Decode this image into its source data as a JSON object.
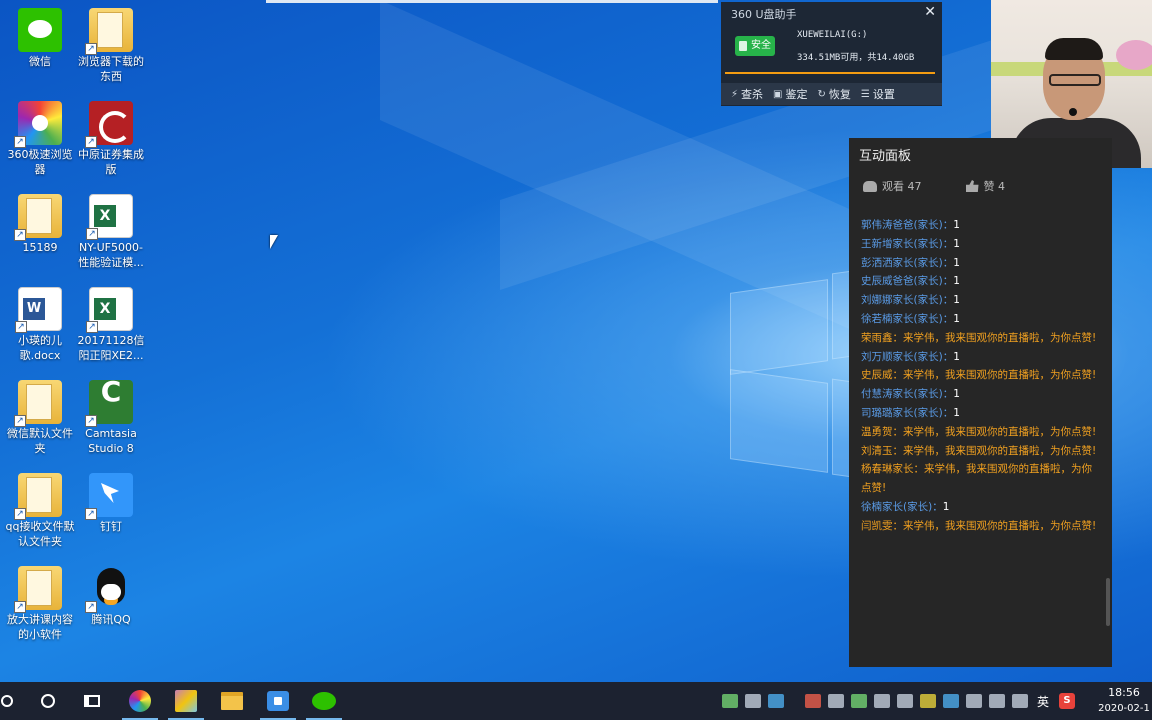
{
  "desktop": {
    "icons": [
      {
        "label": "微信",
        "icon": "wechat-icon"
      },
      {
        "label": "浏览器下载的东西",
        "icon": "folder-icon"
      },
      {
        "label": "360极速浏览器",
        "icon": "360-browser-icon"
      },
      {
        "label": "中原证券集成版",
        "icon": "zhongyuan-securities-icon"
      },
      {
        "label": "15189",
        "icon": "folder-icon"
      },
      {
        "label": "NY-UF5000-性能验证模...",
        "icon": "excel-file-icon"
      },
      {
        "label": "小瑛的儿歌.docx",
        "icon": "word-file-icon"
      },
      {
        "label": "20171128信阳正阳XE2...",
        "icon": "excel-file-icon"
      },
      {
        "label": "微信默认文件夹",
        "icon": "folder-icon"
      },
      {
        "label": "Camtasia Studio 8",
        "icon": "camtasia-icon"
      },
      {
        "label": "qq接收文件默认文件夹",
        "icon": "folder-icon"
      },
      {
        "label": "钉钉",
        "icon": "dingtalk-icon"
      },
      {
        "label": "放大讲课内容的小软件",
        "icon": "folder-icon"
      },
      {
        "label": "腾讯QQ",
        "icon": "qq-icon"
      }
    ]
  },
  "usb_helper": {
    "title": "360 U盘助手",
    "status_badge": "安全",
    "drive_name": "XUEWEILAI(G:)",
    "capacity": "334.51MB可用，共14.40GB",
    "menu": [
      {
        "label": "查杀",
        "icon": "lightning-icon"
      },
      {
        "label": "鉴定",
        "icon": "lock-icon"
      },
      {
        "label": "恢复",
        "icon": "restore-icon"
      },
      {
        "label": "设置",
        "icon": "list-icon"
      }
    ]
  },
  "panel": {
    "title": "互动面板",
    "viewers": "观看 47",
    "likes": "赞 4",
    "messages": [
      {
        "name": "郭伟涛爸爸(家长)",
        "text": "1",
        "highlight": false
      },
      {
        "name": "王新增家长(家长)",
        "text": "1",
        "highlight": false
      },
      {
        "name": "彭洒洒家长(家长)",
        "text": "1",
        "highlight": false
      },
      {
        "name": "史辰威爸爸(家长)",
        "text": "1",
        "highlight": false
      },
      {
        "name": "刘娜娜家长(家长)",
        "text": "1",
        "highlight": false
      },
      {
        "name": "徐若楠家长(家长)",
        "text": "1",
        "highlight": false
      },
      {
        "name": "荣雨鑫",
        "text": "来学伟，我来围观你的直播啦，为你点赞!",
        "highlight": true
      },
      {
        "name": "刘万顺家长(家长)",
        "text": "1",
        "highlight": false
      },
      {
        "name": "史辰威",
        "text": "来学伟，我来围观你的直播啦，为你点赞!",
        "highlight": true
      },
      {
        "name": "付慧涛家长(家长)",
        "text": "1",
        "highlight": false
      },
      {
        "name": "司璐璐家长(家长)",
        "text": "1",
        "highlight": false
      },
      {
        "name": "温勇贺",
        "text": "来学伟，我来围观你的直播啦，为你点赞!",
        "highlight": true
      },
      {
        "name": "刘清玉",
        "text": "来学伟，我来围观你的直播啦，为你点赞!",
        "highlight": true
      },
      {
        "name": "杨春琳家长",
        "text": "来学伟，我来围观你的直播啦，为你点赞!",
        "highlight": true
      },
      {
        "name": "徐楠家长(家长)",
        "text": "1",
        "highlight": false
      },
      {
        "name": "闫凯雯",
        "text": "来学伟，我来围观你的直播啦，为你点赞!",
        "highlight": true
      }
    ]
  },
  "taskbar": {
    "apps": [
      "search-icon",
      "cortana-icon",
      "task-view-icon",
      "360-browser-icon",
      "photo-viewer-icon",
      "file-explorer-icon",
      "screen-recorder-icon",
      "wechat-icon"
    ],
    "input_language": "英",
    "sogou_label": "S",
    "time": "18:56",
    "date": "2020-02-1"
  }
}
